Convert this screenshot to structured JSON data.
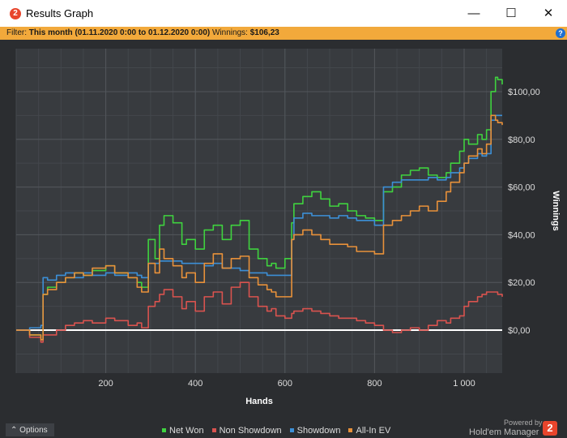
{
  "window": {
    "title": "Results Graph",
    "app_icon_glyph": "2",
    "minimize": "—",
    "maximize": "☐",
    "close": "✕"
  },
  "filter": {
    "prefix": "Filter: ",
    "range": "This month (01.11.2020 0:00 to 01.12.2020 0:00)",
    "winnings_label": "  Winnings: ",
    "winnings_value": "$106,23",
    "help": "?"
  },
  "footer": {
    "options_label": "Options",
    "options_glyph": "⌃",
    "powered_by": "Powered by",
    "brand": "Hold'em Manager",
    "brand_glyph": "2"
  },
  "colors": {
    "net_won": "#3fd23f",
    "non_showdown": "#d9534f",
    "showdown": "#3c8fd6",
    "all_in_ev": "#e8913a",
    "filter_bar": "#f2a93b",
    "plot_bg": "#383b3f"
  },
  "chart_data": {
    "type": "line",
    "xlabel": "Hands",
    "ylabel": "Winnings",
    "xlim": [
      0,
      1085
    ],
    "ylim": [
      -18,
      118
    ],
    "x_ticks": [
      200,
      400,
      600,
      800,
      1000
    ],
    "x_tick_labels": [
      "200",
      "400",
      "600",
      "800",
      "1 000"
    ],
    "y_ticks": [
      0,
      20,
      40,
      60,
      80,
      100
    ],
    "y_tick_labels": [
      "$0,00",
      "$20,00",
      "$40,00",
      "$60,00",
      "$80,00",
      "$100,00"
    ],
    "grid": true,
    "legend_position": "bottom",
    "series": [
      {
        "name": "Net Won",
        "color": "#3fd23f",
        "x": [
          0,
          30,
          55,
          60,
          70,
          90,
          110,
          130,
          150,
          170,
          200,
          220,
          250,
          270,
          280,
          295,
          310,
          320,
          330,
          350,
          370,
          380,
          400,
          420,
          440,
          460,
          480,
          500,
          520,
          540,
          560,
          570,
          580,
          600,
          615,
          620,
          640,
          660,
          680,
          700,
          720,
          740,
          760,
          780,
          800,
          820,
          840,
          860,
          880,
          900,
          920,
          940,
          960,
          970,
          990,
          1000,
          1010,
          1030,
          1040,
          1050,
          1060,
          1070,
          1075,
          1085
        ],
        "y": [
          0,
          -2,
          -4,
          15,
          18,
          20,
          22,
          24,
          23,
          25,
          27,
          24,
          22,
          20,
          18,
          38,
          30,
          44,
          48,
          45,
          36,
          38,
          34,
          42,
          44,
          38,
          44,
          46,
          34,
          30,
          27,
          28,
          26,
          30,
          45,
          53,
          56,
          58,
          55,
          52,
          53,
          50,
          48,
          47,
          46,
          58,
          60,
          65,
          67,
          68,
          65,
          64,
          66,
          70,
          75,
          80,
          78,
          82,
          80,
          84,
          100,
          106,
          105,
          103
        ]
      },
      {
        "name": "Non Showdown",
        "color": "#d9534f",
        "x": [
          0,
          30,
          55,
          60,
          70,
          90,
          110,
          130,
          150,
          170,
          200,
          220,
          250,
          270,
          280,
          295,
          310,
          320,
          330,
          350,
          370,
          380,
          400,
          420,
          440,
          460,
          480,
          500,
          520,
          540,
          560,
          570,
          580,
          600,
          615,
          620,
          640,
          660,
          680,
          700,
          720,
          740,
          760,
          780,
          800,
          820,
          840,
          860,
          880,
          900,
          920,
          940,
          960,
          970,
          990,
          1000,
          1010,
          1030,
          1040,
          1050,
          1060,
          1070,
          1075,
          1085
        ],
        "y": [
          0,
          -3,
          -5,
          -2,
          -2,
          0,
          2,
          3,
          4,
          3,
          5,
          4,
          2,
          3,
          1,
          10,
          12,
          15,
          17,
          14,
          9,
          12,
          8,
          14,
          16,
          11,
          18,
          20,
          14,
          10,
          8,
          9,
          6,
          5,
          7,
          8,
          9,
          8,
          7,
          6,
          5,
          5,
          4,
          3,
          2,
          0,
          -1,
          0,
          1,
          0,
          2,
          4,
          3,
          5,
          6,
          10,
          12,
          14,
          15,
          16,
          16,
          16,
          15,
          14
        ]
      },
      {
        "name": "Showdown",
        "color": "#3c8fd6",
        "x": [
          0,
          30,
          55,
          60,
          70,
          90,
          110,
          130,
          150,
          170,
          200,
          220,
          250,
          270,
          280,
          295,
          310,
          320,
          330,
          350,
          370,
          380,
          400,
          420,
          440,
          460,
          480,
          500,
          520,
          540,
          560,
          570,
          580,
          600,
          615,
          620,
          640,
          660,
          680,
          700,
          720,
          740,
          760,
          780,
          800,
          820,
          840,
          860,
          880,
          900,
          920,
          940,
          960,
          970,
          990,
          1000,
          1010,
          1030,
          1040,
          1050,
          1060,
          1070,
          1075,
          1085
        ],
        "y": [
          0,
          1,
          2,
          22,
          21,
          23,
          24,
          22,
          24,
          23,
          24,
          23,
          24,
          23,
          22,
          28,
          28,
          29,
          29,
          29,
          28,
          28,
          28,
          27,
          28,
          26,
          26,
          25,
          24,
          24,
          23,
          23,
          23,
          23,
          38,
          47,
          49,
          48,
          48,
          47,
          48,
          47,
          46,
          46,
          44,
          60,
          62,
          63,
          63,
          63,
          64,
          63,
          64,
          66,
          68,
          70,
          72,
          74,
          73,
          74,
          88,
          90,
          90,
          90
        ]
      },
      {
        "name": "All-In EV",
        "color": "#e8913a",
        "x": [
          0,
          30,
          55,
          60,
          70,
          90,
          110,
          130,
          150,
          170,
          200,
          220,
          250,
          270,
          280,
          295,
          310,
          320,
          330,
          350,
          370,
          380,
          400,
          420,
          440,
          460,
          480,
          500,
          520,
          540,
          560,
          570,
          580,
          600,
          615,
          620,
          640,
          660,
          680,
          700,
          720,
          740,
          760,
          780,
          800,
          820,
          840,
          860,
          880,
          900,
          920,
          940,
          960,
          970,
          990,
          1000,
          1010,
          1030,
          1040,
          1050,
          1060,
          1070,
          1075,
          1085
        ],
        "y": [
          0,
          -2,
          -4,
          15,
          17,
          20,
          22,
          24,
          23,
          26,
          27,
          24,
          22,
          18,
          16,
          28,
          24,
          34,
          30,
          27,
          22,
          24,
          20,
          28,
          32,
          26,
          30,
          31,
          22,
          19,
          17,
          16,
          14,
          14,
          38,
          40,
          42,
          40,
          38,
          36,
          36,
          35,
          33,
          33,
          32,
          44,
          46,
          48,
          50,
          52,
          50,
          54,
          58,
          62,
          66,
          70,
          73,
          76,
          74,
          78,
          90,
          88,
          87,
          86
        ]
      }
    ]
  }
}
